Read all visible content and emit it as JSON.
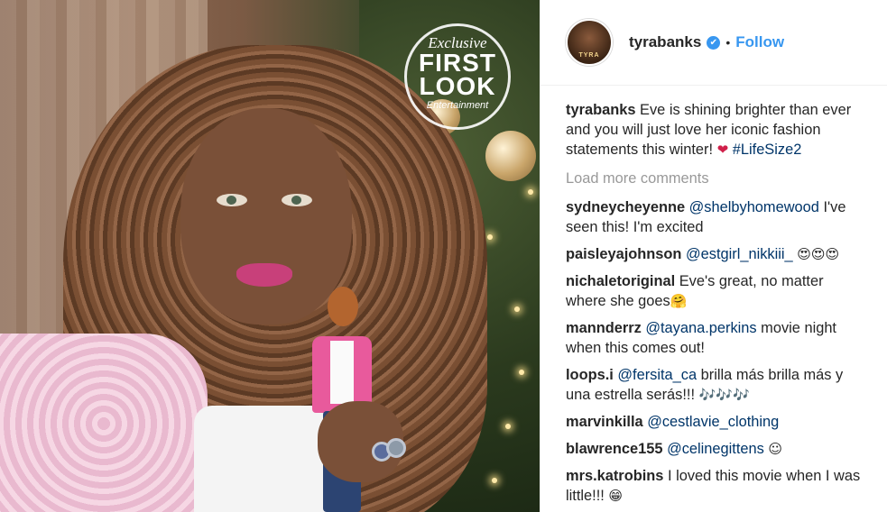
{
  "media": {
    "badge": {
      "line1": "Exclusive",
      "line2": "FIRST",
      "line3": "LOOK",
      "line4": "Entertainment"
    }
  },
  "header": {
    "avatar_text": "TYRA",
    "username": "tyrabanks",
    "verified_icon": "✔",
    "separator": "•",
    "follow_label": "Follow"
  },
  "caption": {
    "user": "tyrabanks",
    "text": "Eve is shining brighter than ever and you will just love her iconic fashion statements this winter!",
    "emoji": "❤",
    "hashtag": "#LifeSize2"
  },
  "load_more_label": "Load more comments",
  "comments": [
    {
      "user": "sydneycheyenne",
      "mention": "@shelbyhomewood",
      "text": "I've seen this! I'm excited",
      "emoji": ""
    },
    {
      "user": "paisleyajohnson",
      "mention": "@estgirl_nikkiii_",
      "text": "",
      "emoji": "😍😍😍"
    },
    {
      "user": "nichaletoriginal",
      "mention": "",
      "text": "Eve's great, no matter where she goes",
      "emoji": "🤗"
    },
    {
      "user": "mannderrz",
      "mention": "@tayana.perkins",
      "text": "movie night when this comes out!",
      "emoji": ""
    },
    {
      "user": "loops.i",
      "mention": "@fersita_ca",
      "text": "brilla más brilla más y una estrella serás!!!",
      "emoji": "🎶🎶🎶"
    },
    {
      "user": "marvinkilla",
      "mention": "@cestlavie_clothing",
      "text": "",
      "emoji": ""
    },
    {
      "user": "blawrence155",
      "mention": "@celinegittens",
      "text": "",
      "emoji": "☺"
    },
    {
      "user": "mrs.katrobins",
      "mention": "",
      "text": "I loved this movie when I was little!!!",
      "emoji": "😁"
    }
  ]
}
